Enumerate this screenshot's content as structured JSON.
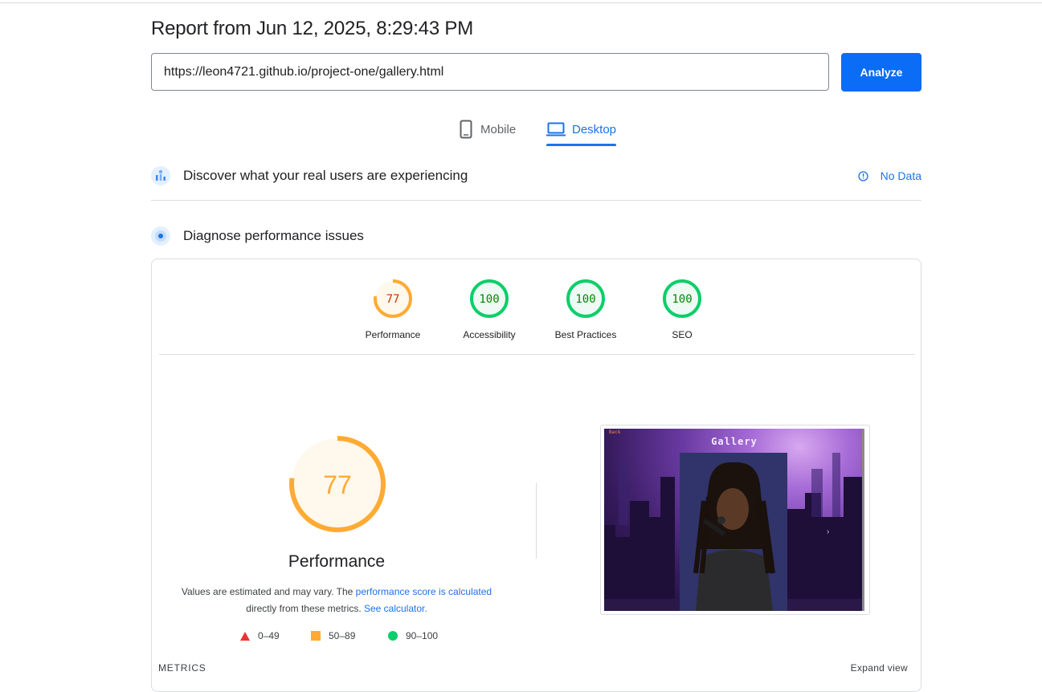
{
  "header": {
    "title": "Report from Jun 12, 2025, 8:29:43 PM",
    "url_value": "https://leon4721.github.io/project-one/gallery.html",
    "analyze_label": "Analyze"
  },
  "tabs": [
    {
      "label": "Mobile",
      "icon": "phone-icon",
      "selected": false
    },
    {
      "label": "Desktop",
      "icon": "laptop-icon",
      "selected": true
    }
  ],
  "field_data": {
    "title": "Discover what your real users are experiencing",
    "status_label": "No Data",
    "icon": "users-chart-icon"
  },
  "lab_data": {
    "title": "Diagnose performance issues",
    "icon": "diagnose-target-icon"
  },
  "categories": [
    {
      "label": "Performance",
      "score": "77",
      "score_value": 77,
      "color": "#fa3",
      "text_color": "#c33300",
      "fill": "#fff8ec"
    },
    {
      "label": "Accessibility",
      "score": "100",
      "score_value": 100,
      "color": "#0cce6b",
      "text_color": "#008800",
      "fill": "#eefaf3"
    },
    {
      "label": "Best Practices",
      "score": "100",
      "score_value": 100,
      "color": "#0cce6b",
      "text_color": "#008800",
      "fill": "#eefaf3"
    },
    {
      "label": "SEO",
      "score": "100",
      "score_value": 100,
      "color": "#0cce6b",
      "text_color": "#008800",
      "fill": "#eefaf3"
    }
  ],
  "performance": {
    "score": "77",
    "score_value": 77,
    "title": "Performance",
    "desc_prefix": "Values are estimated and may vary. The ",
    "desc_link1": "performance score is calculated",
    "desc_middle": " directly from these metrics. ",
    "desc_link2": "See calculator."
  },
  "legend": [
    {
      "range": "0–49",
      "shape": "triangle",
      "color": "#e33"
    },
    {
      "range": "50–89",
      "shape": "square",
      "color": "#fa3"
    },
    {
      "range": "90–100",
      "shape": "circle",
      "color": "#0cce6b"
    }
  ],
  "screenshot": {
    "back_label": "Back",
    "page_title": "Gallery",
    "next_arrow": "›"
  },
  "metrics": {
    "label": "METRICS",
    "expand_label": "Expand view"
  },
  "colors": {
    "accent": "#1a73e8",
    "analyze_button": "#0b6cf5"
  }
}
